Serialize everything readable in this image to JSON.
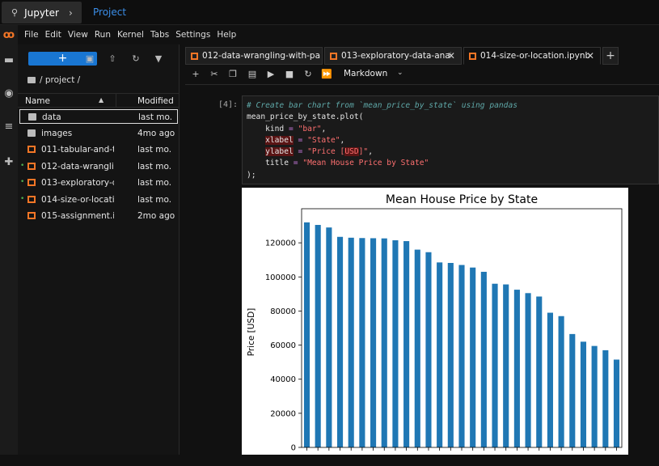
{
  "topbar": {
    "app_name": "Jupyter",
    "project_link": "Project"
  },
  "menu": [
    "File",
    "Edit",
    "View",
    "Run",
    "Kernel",
    "Tabs",
    "Settings",
    "Help"
  ],
  "filebrowser": {
    "new_label": "+",
    "breadcrumb": "/ project /",
    "col_name": "Name",
    "col_modified": "Modified",
    "files": [
      {
        "name": "data",
        "modified": "last mo.",
        "type": "folder",
        "running": false,
        "selected": true
      },
      {
        "name": "images",
        "modified": "4mo ago",
        "type": "folder",
        "running": false,
        "selected": false
      },
      {
        "name": "011-tabular-and-t...",
        "modified": "last mo.",
        "type": "notebook",
        "running": false,
        "selected": false
      },
      {
        "name": "012-data-wranglin...",
        "modified": "last mo.",
        "type": "notebook",
        "running": true,
        "selected": false
      },
      {
        "name": "013-exploratory-d...",
        "modified": "last mo.",
        "type": "notebook",
        "running": true,
        "selected": false
      },
      {
        "name": "014-size-or-locati...",
        "modified": "last mo.",
        "type": "notebook",
        "running": true,
        "selected": false
      },
      {
        "name": "015-assignment.ip...",
        "modified": "2mo ago",
        "type": "notebook",
        "running": false,
        "selected": false
      }
    ]
  },
  "tabs": [
    {
      "label": "012-data-wrangling-with-pa",
      "active": false
    },
    {
      "label": "013-exploratory-data-analysi",
      "active": false
    },
    {
      "label": "014-size-or-location.ipynb",
      "active": true
    }
  ],
  "toolbar": {
    "cell_type": "Markdown"
  },
  "cell": {
    "prompt": "[4]:",
    "comment": "# Create bar chart from `mean_price_by_state` using pandas",
    "line1": "mean_price_by_state.plot(",
    "kind_key": "kind",
    "kind_val": "\"bar\"",
    "xlabel_key": "xlabel",
    "xlabel_val": "\"State\"",
    "ylabel_key": "ylabel",
    "ylabel_val_a": "\"Price [",
    "ylabel_val_b": "USD",
    "ylabel_val_c": "]\"",
    "title_key": "title",
    "title_val": "\"Mean House Price by State\"",
    "close": ");"
  },
  "chart_data": {
    "type": "bar",
    "title": "Mean House Price by State",
    "ylabel": "Price [USD]",
    "xlabel": "",
    "ylim": [
      0,
      140000
    ],
    "yticks": [
      0,
      20000,
      40000,
      60000,
      80000,
      100000,
      120000
    ],
    "values": [
      132000,
      130500,
      129000,
      123500,
      123000,
      122800,
      122700,
      122600,
      121500,
      121000,
      116000,
      114500,
      108500,
      108200,
      107000,
      105500,
      103000,
      96000,
      95600,
      92500,
      90500,
      88500,
      79000,
      77000,
      66500,
      62000,
      59500,
      57000,
      51500
    ],
    "color": "#1f77b4"
  }
}
